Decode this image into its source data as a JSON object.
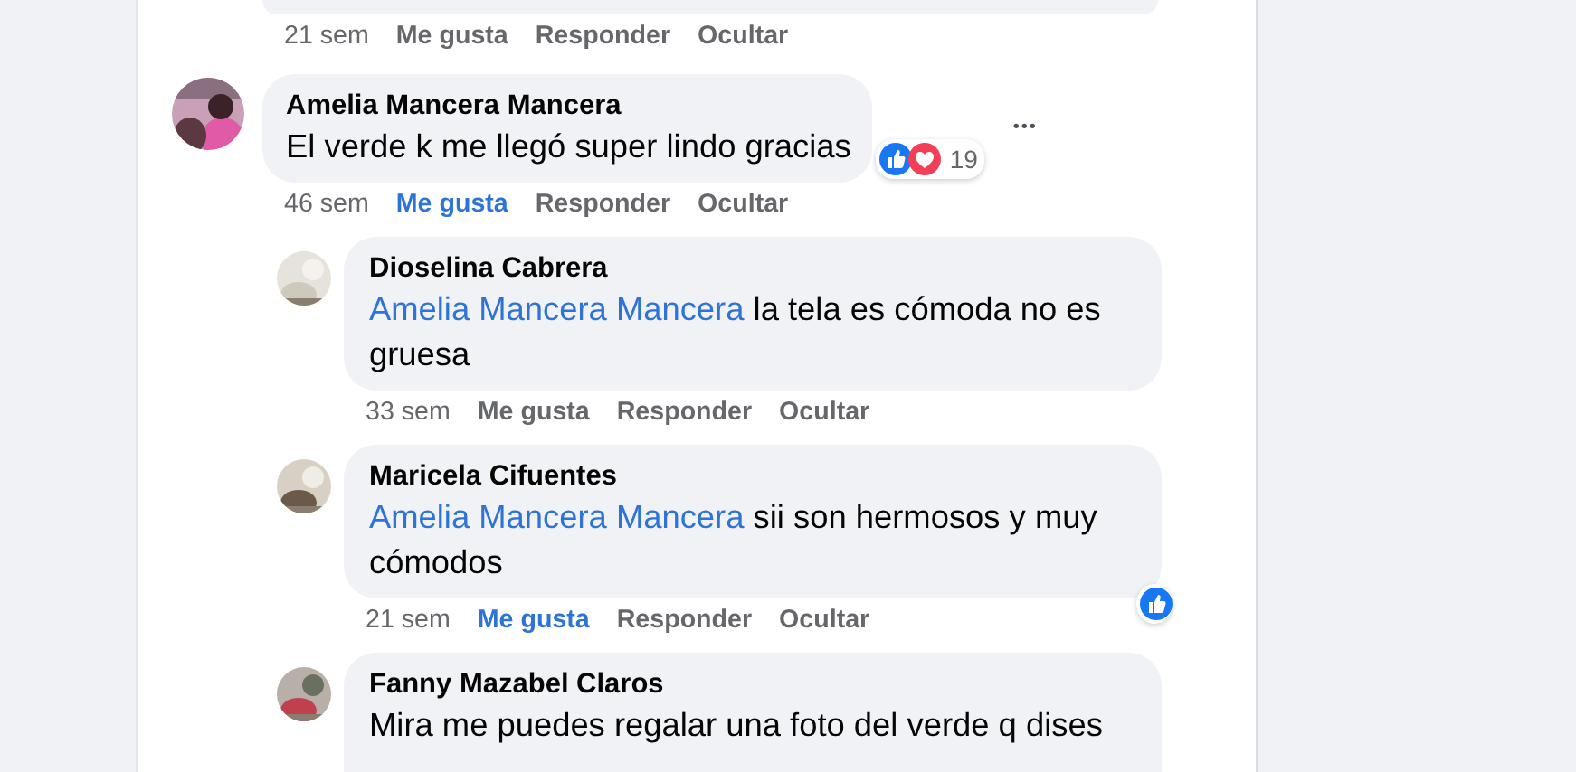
{
  "previous_comment_actions": {
    "time": "21 sem",
    "like": "Me gusta",
    "liked": false,
    "reply": "Responder",
    "hide": "Ocultar"
  },
  "comments": [
    {
      "author": "Amelia Mancera Mancera",
      "text": "El verde k me llegó super lindo gracias",
      "time": "46 sem",
      "like": "Me gusta",
      "liked": true,
      "reply": "Responder",
      "hide": "Ocultar",
      "more": "•••",
      "reactions": {
        "kinds": [
          {
            "kind": "like"
          },
          {
            "kind": "love"
          }
        ],
        "count": "19"
      },
      "replies": [
        {
          "author": "Dioselina Cabrera",
          "mention": "Amelia Mancera Mancera",
          "text": "la tela es cómoda no es gruesa",
          "time": "33 sem",
          "like": "Me gusta",
          "liked": false,
          "reply": "Responder",
          "hide": "Ocultar"
        },
        {
          "author": "Maricela Cifuentes",
          "mention": "Amelia Mancera Mancera",
          "text": "sii son hermosos y muy cómodos",
          "time": "21 sem",
          "like": "Me gusta",
          "liked": true,
          "reply": "Responder",
          "hide": "Ocultar",
          "reactions": {
            "kinds": [
              {
                "kind": "like"
              }
            ]
          }
        },
        {
          "author": "Fanny Mazabel Claros",
          "text": "Mira me puedes regalar una foto del verde q dises"
        }
      ]
    }
  ]
}
